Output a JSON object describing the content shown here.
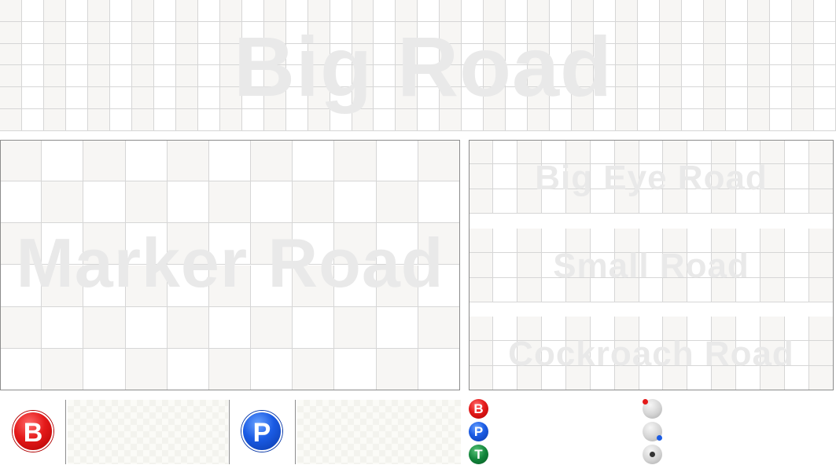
{
  "roads": {
    "big_road": {
      "label": "Big Road",
      "rows": 6,
      "cols": 38
    },
    "marker_road": {
      "label": "Marker Road",
      "rows": 6,
      "cols": 11
    },
    "big_eye_road": {
      "label": "Big Eye Road",
      "rows": 3,
      "cols": 15
    },
    "small_road": {
      "label": "Small Road",
      "rows": 3,
      "cols": 15
    },
    "cockroach_road": {
      "label": "Cockroach Road",
      "rows": 3,
      "cols": 15
    }
  },
  "predict": {
    "banker": {
      "letter": "B",
      "color": "#e41a1a"
    },
    "player": {
      "letter": "P",
      "color": "#1a5be4"
    }
  },
  "legend": {
    "banker": {
      "letter": "B",
      "color": "#e41a1a"
    },
    "player": {
      "letter": "P",
      "color": "#1a5be4"
    },
    "tie": {
      "letter": "T",
      "color": "#11853a"
    },
    "banker_pair_icon": "red-dot-top-left",
    "player_pair_icon": "blue-dot-bottom-right",
    "natural_icon": "dark-dot-center"
  }
}
